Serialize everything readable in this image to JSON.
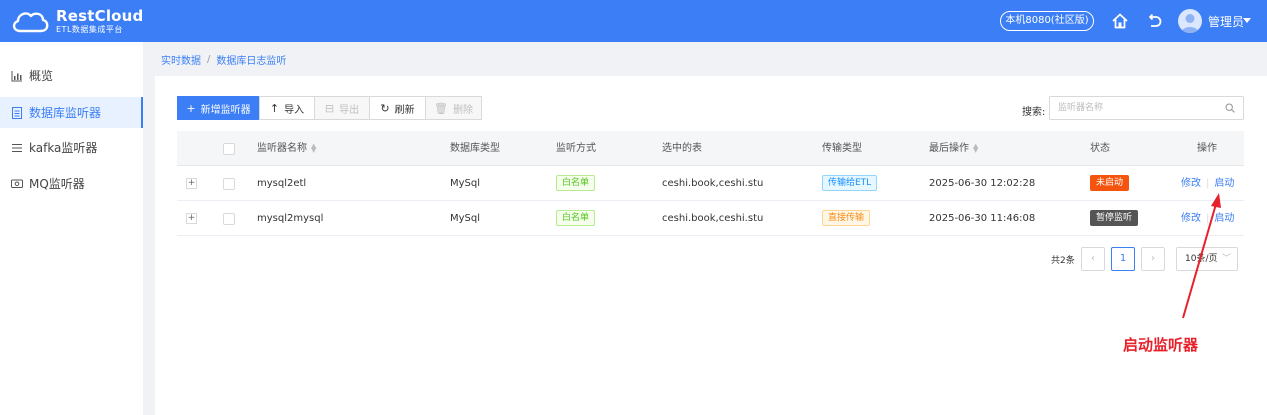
{
  "header": {
    "logo_title": "RestCloud",
    "logo_subtitle": "ETL数据集成平台",
    "env_badge": "本机8080(社区版)",
    "user_name": "管理员",
    "icons": {
      "home": "home-icon",
      "back": "back-icon",
      "avatar": "avatar-icon",
      "caret": "caret-down-icon"
    },
    "colors": {
      "bar": "#3b7ef6"
    }
  },
  "sidebar": {
    "items": [
      {
        "label": "概览",
        "icon": "chart-icon",
        "active": false
      },
      {
        "label": "数据库监听器",
        "icon": "document-icon",
        "active": true
      },
      {
        "label": "kafka监听器",
        "icon": "list-icon",
        "active": false
      },
      {
        "label": "MQ监听器",
        "icon": "monitor-icon",
        "active": false
      }
    ]
  },
  "breadcrumb": [
    "实时数据",
    "数据库日志监听"
  ],
  "toolbar": {
    "add_label": "新增监听器",
    "import_label": "导入",
    "export_label": "导出",
    "refresh_label": "刷新",
    "delete_label": "删除"
  },
  "search": {
    "label": "搜索:",
    "placeholder": "监听器名称"
  },
  "table": {
    "headers": [
      "监听器名称",
      "数据库类型",
      "监听方式",
      "选中的表",
      "传输类型",
      "最后操作",
      "状态",
      "操作"
    ],
    "rows": [
      {
        "name": "mysql2etl",
        "db_type": "MySql",
        "listen_mode": "白名单",
        "tables": "ceshi.book,ceshi.stu",
        "transfer_type": "传输给ETL",
        "last_op": "2025-06-30 12:02:28",
        "status": "未启动",
        "op_edit": "修改",
        "op_start": "启动"
      },
      {
        "name": "mysql2mysql",
        "db_type": "MySql",
        "listen_mode": "白名单",
        "tables": "ceshi.book,ceshi.stu",
        "transfer_type": "直接传输",
        "last_op": "2025-06-30 11:46:08",
        "status": "暂停监听",
        "op_edit": "修改",
        "op_start": "启动"
      }
    ]
  },
  "pagination": {
    "total": "共2条",
    "current_page": "1",
    "page_size": "10条/页"
  },
  "annotation": {
    "text": "启动监听器",
    "color": "#e8202a"
  }
}
